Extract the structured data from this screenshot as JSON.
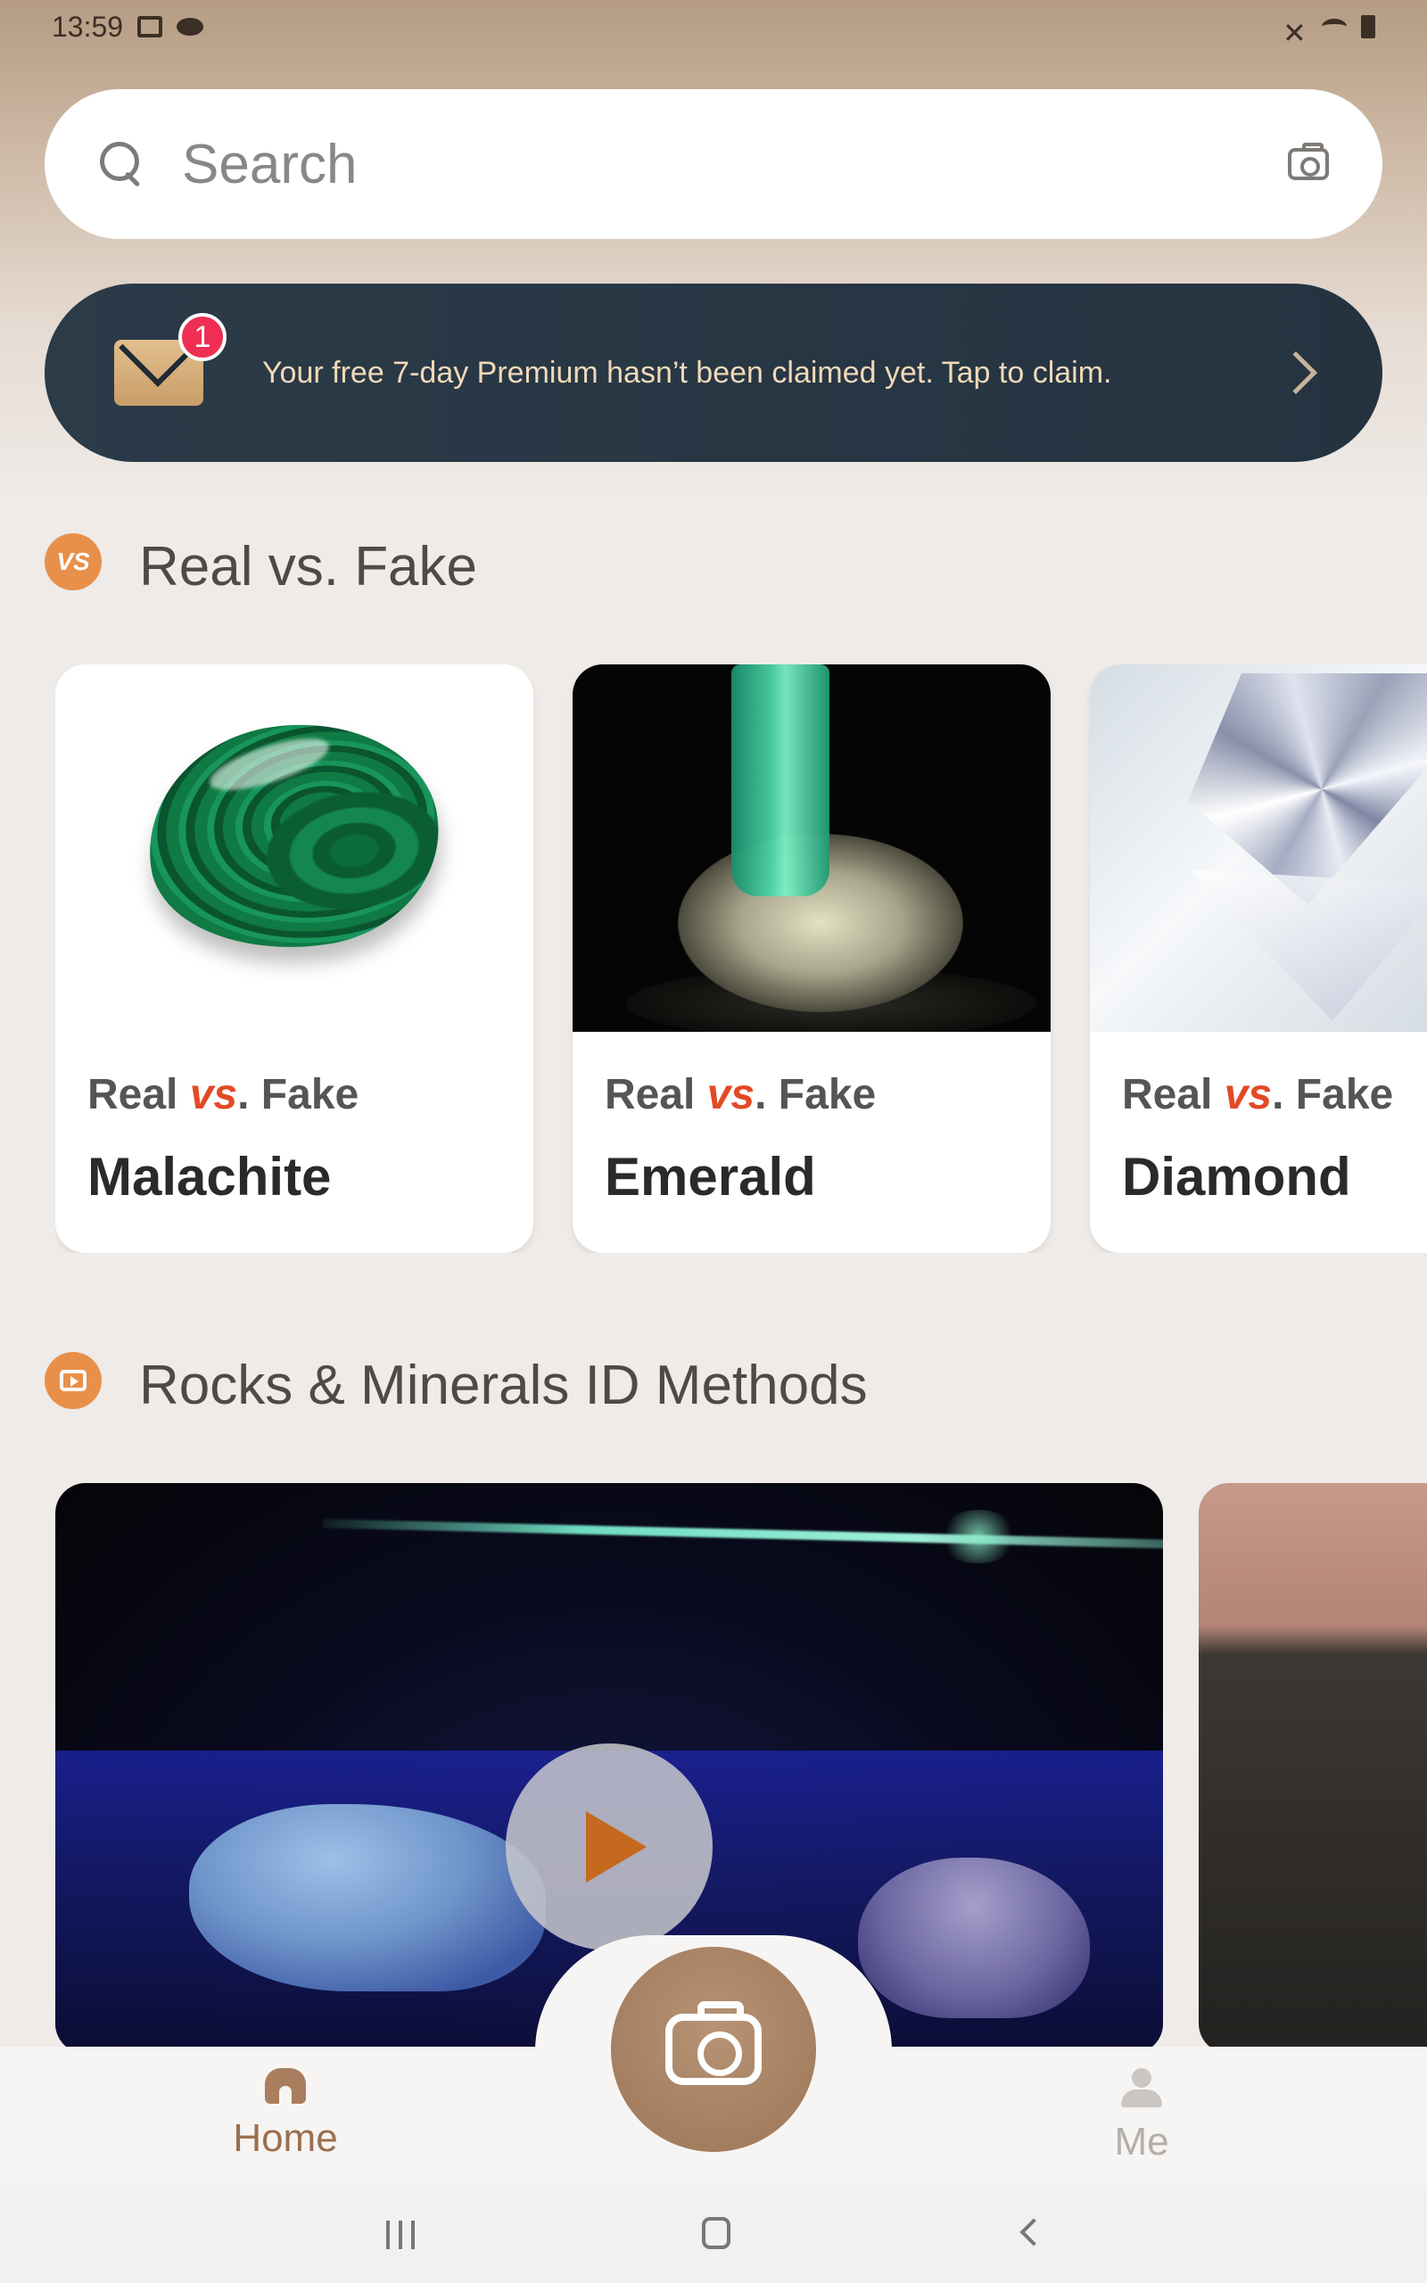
{
  "status_bar": {
    "time": "13:59",
    "left_icons": [
      "image-icon",
      "cloud-icon"
    ],
    "right_icons": [
      "mute-icon",
      "wifi-icon",
      "battery-icon"
    ]
  },
  "search": {
    "placeholder": "Search",
    "camera_icon": "camera-icon"
  },
  "promo": {
    "badge_count": "1",
    "text": "Your free 7-day Premium hasn’t been claimed yet. Tap to claim.",
    "icon": "mail-icon"
  },
  "sections": {
    "real_vs_fake": {
      "icon_label": "VS",
      "title": "Real vs. Fake",
      "cards": [
        {
          "sub_real": "Real ",
          "sub_vs": "vs",
          "sub_fake": ". Fake",
          "title": "Malachite"
        },
        {
          "sub_real": "Real ",
          "sub_vs": "vs",
          "sub_fake": ". Fake",
          "title": "Emerald"
        },
        {
          "sub_real": "Real ",
          "sub_vs": "vs",
          "sub_fake": ". Fake",
          "title": "Diamond"
        }
      ]
    },
    "id_methods": {
      "icon": "video-icon",
      "title": "Rocks & Minerals ID Methods"
    }
  },
  "bottom_nav": {
    "home_label": "Home",
    "me_label": "Me",
    "center_icon": "camera-icon"
  },
  "colors": {
    "accent": "#e8904a",
    "vs_red": "#e24a25",
    "banner_bg": "#2b3b48",
    "fab": "#a8835f"
  }
}
